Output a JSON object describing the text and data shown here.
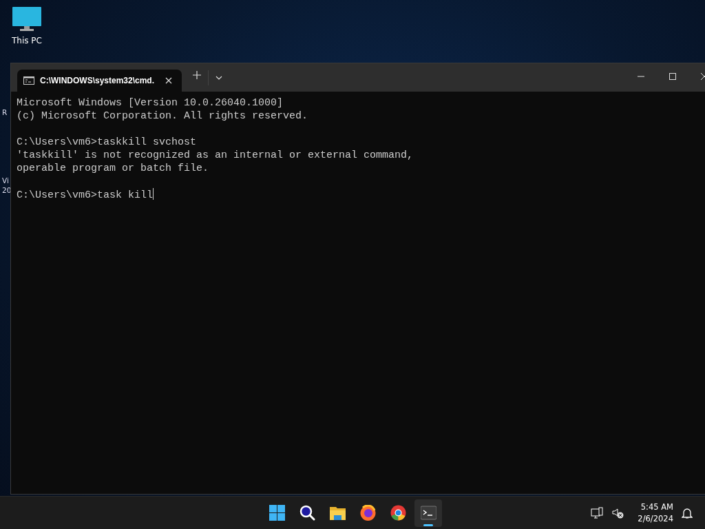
{
  "desktop": {
    "icons": [
      {
        "label": "This PC"
      }
    ],
    "edge_texts": [
      "R",
      "Vi",
      "20"
    ]
  },
  "window": {
    "tab": {
      "title": "C:\\WINDOWS\\system32\\cmd."
    },
    "console": {
      "blocks": [
        [
          "Microsoft Windows [Version 10.0.26040.1000]",
          "(c) Microsoft Corporation. All rights reserved."
        ],
        [
          "C:\\Users\\vm6>taskkill svchost",
          "'taskkill' is not recognized as an internal or external command,",
          "operable program or batch file."
        ]
      ],
      "prompt": "C:\\Users\\vm6>task kill"
    }
  },
  "taskbar": {
    "apps": [
      {
        "kind": "start",
        "selected": false
      },
      {
        "kind": "search",
        "selected": false
      },
      {
        "kind": "explorer",
        "selected": false
      },
      {
        "kind": "firefox",
        "selected": false
      },
      {
        "kind": "chrome",
        "selected": false
      },
      {
        "kind": "terminal",
        "selected": true
      }
    ],
    "clock": {
      "time": "5:45 AM",
      "date": "2/6/2024"
    }
  }
}
